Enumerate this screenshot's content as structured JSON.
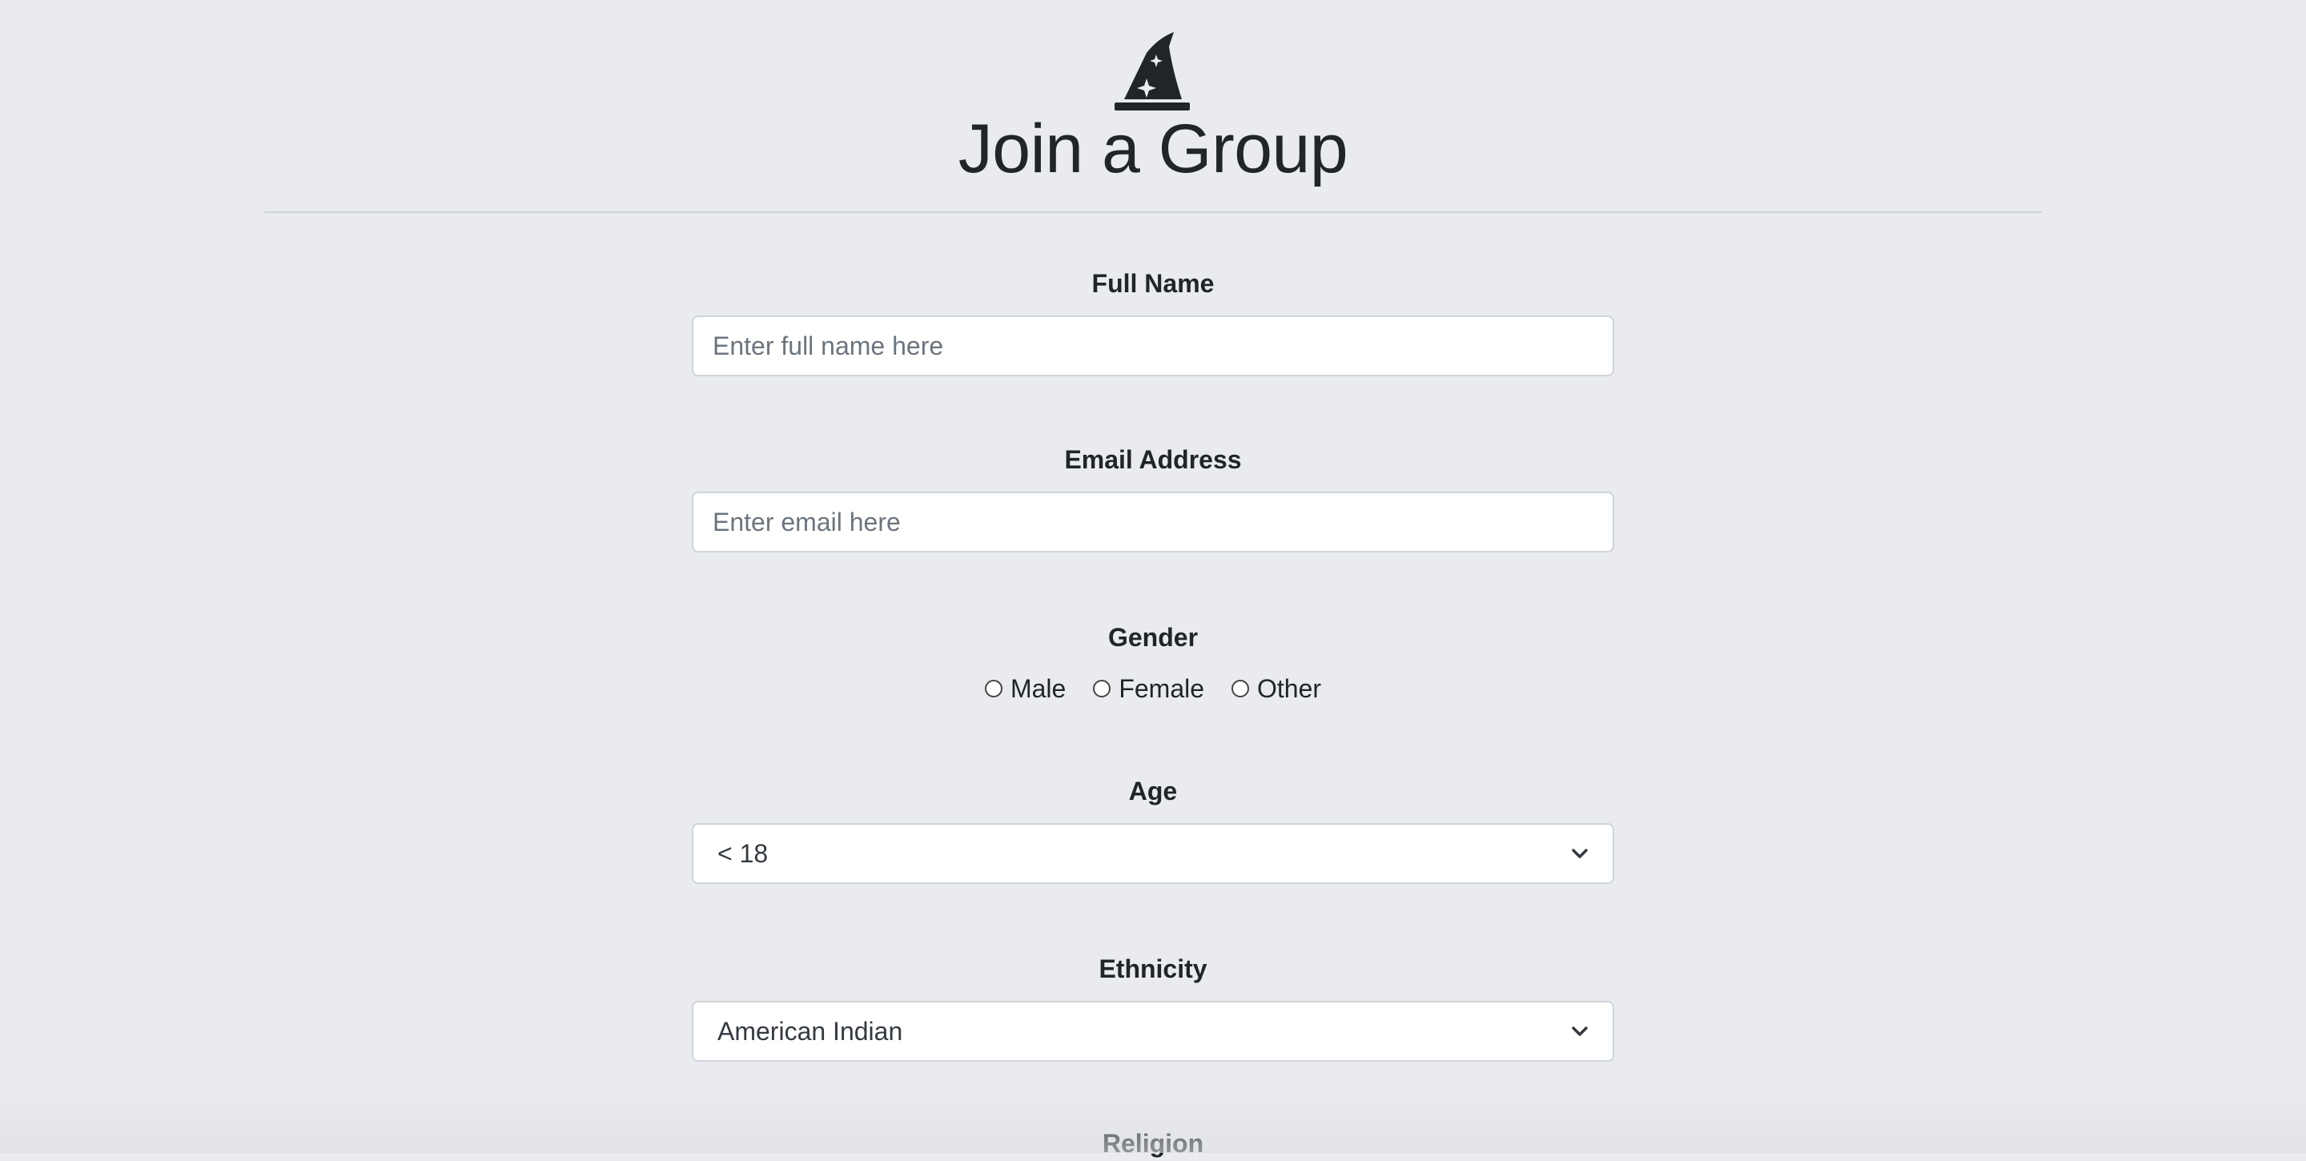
{
  "header": {
    "logo_icon": "wizard-hat-icon",
    "title": "Join a Group"
  },
  "form": {
    "full_name": {
      "label": "Full Name",
      "placeholder": "Enter full name here",
      "value": ""
    },
    "email": {
      "label": "Email Address",
      "placeholder": "Enter email here",
      "value": ""
    },
    "gender": {
      "label": "Gender",
      "options": [
        "Male",
        "Female",
        "Other"
      ]
    },
    "age": {
      "label": "Age",
      "selected": "< 18"
    },
    "ethnicity": {
      "label": "Ethnicity",
      "selected": "American Indian"
    },
    "religion": {
      "label": "Religion"
    }
  },
  "colors": {
    "background": "#e9ebee",
    "text": "#212529",
    "input_border": "#ced4da"
  }
}
